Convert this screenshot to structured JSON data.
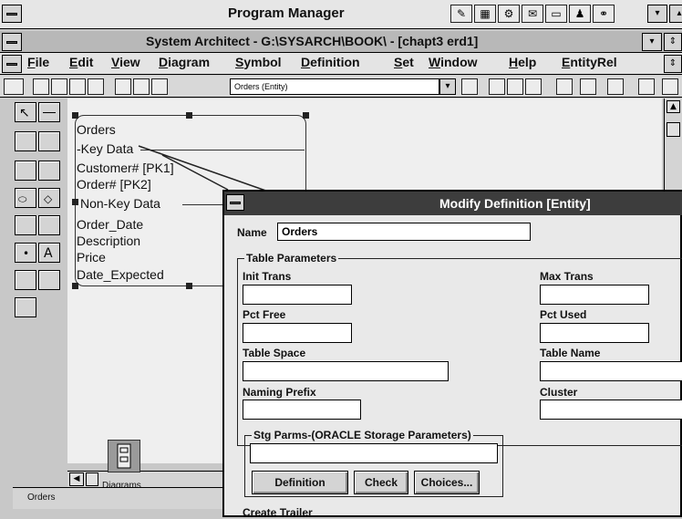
{
  "program_manager": {
    "title": "Program Manager"
  },
  "app": {
    "title": "System Architect - G:\\SYSARCH\\BOOK\\ - [chapt3 erd1]"
  },
  "menu": [
    "File",
    "Edit",
    "View",
    "Diagram",
    "Symbol",
    "Definition",
    "Set",
    "Window",
    "Help",
    "EntityRel"
  ],
  "toolbar": {
    "combo_value": "Orders (Entity)"
  },
  "entity": {
    "name": "Orders",
    "key_label": "-Key Data",
    "key1": "Customer#  [PK1]",
    "key2": "Order#  [PK2]",
    "nonkey_label": "Non-Key Data",
    "attrs": [
      "Order_Date",
      "Description",
      "Price",
      "Date_Expected"
    ]
  },
  "minimized": {
    "label": "Diagrams"
  },
  "status": {
    "text": "Orders"
  },
  "dialog": {
    "title": "Modify  Definition [Entity]",
    "name_label": "Name",
    "name_value": "Orders",
    "group_label": "Table Parameters",
    "init_trans": "Init Trans",
    "max_trans": "Max Trans",
    "pct_free": "Pct Free",
    "pct_used": "Pct Used",
    "table_space": "Table Space",
    "table_name": "Table Name",
    "naming_prefix": "Naming Prefix",
    "cluster": "Cluster",
    "stg_label": "Stg Parms-(ORACLE Storage Parameters)",
    "btn_definition": "Definition",
    "btn_check": "Check",
    "btn_choices": "Choices...",
    "create_trailer": "Create Trailer"
  }
}
